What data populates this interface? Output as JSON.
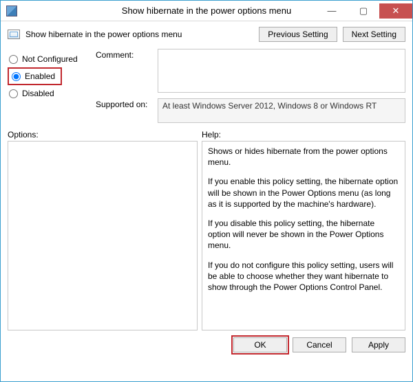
{
  "window": {
    "title": "Show hibernate in the power options menu"
  },
  "header": {
    "policy_title": "Show hibernate in the power options menu",
    "previous": "Previous Setting",
    "next": "Next Setting"
  },
  "state": {
    "not_configured": "Not Configured",
    "enabled": "Enabled",
    "disabled": "Disabled",
    "selected": "enabled"
  },
  "comment": {
    "label": "Comment:",
    "value": ""
  },
  "supported": {
    "label": "Supported on:",
    "value": "At least Windows Server 2012, Windows 8 or Windows RT"
  },
  "sections": {
    "options": "Options:",
    "help": "Help:"
  },
  "help": {
    "p1": "Shows or hides hibernate from the power options menu.",
    "p2": "If you enable this policy setting, the hibernate option will be shown in the Power Options menu (as long as it is supported by the machine's hardware).",
    "p3": "If you disable this policy setting, the hibernate option will never be shown in the Power Options menu.",
    "p4": "If you do not configure this policy setting, users will be able to choose whether they want hibernate to show through the Power Options Control Panel."
  },
  "footer": {
    "ok": "OK",
    "cancel": "Cancel",
    "apply": "Apply"
  }
}
